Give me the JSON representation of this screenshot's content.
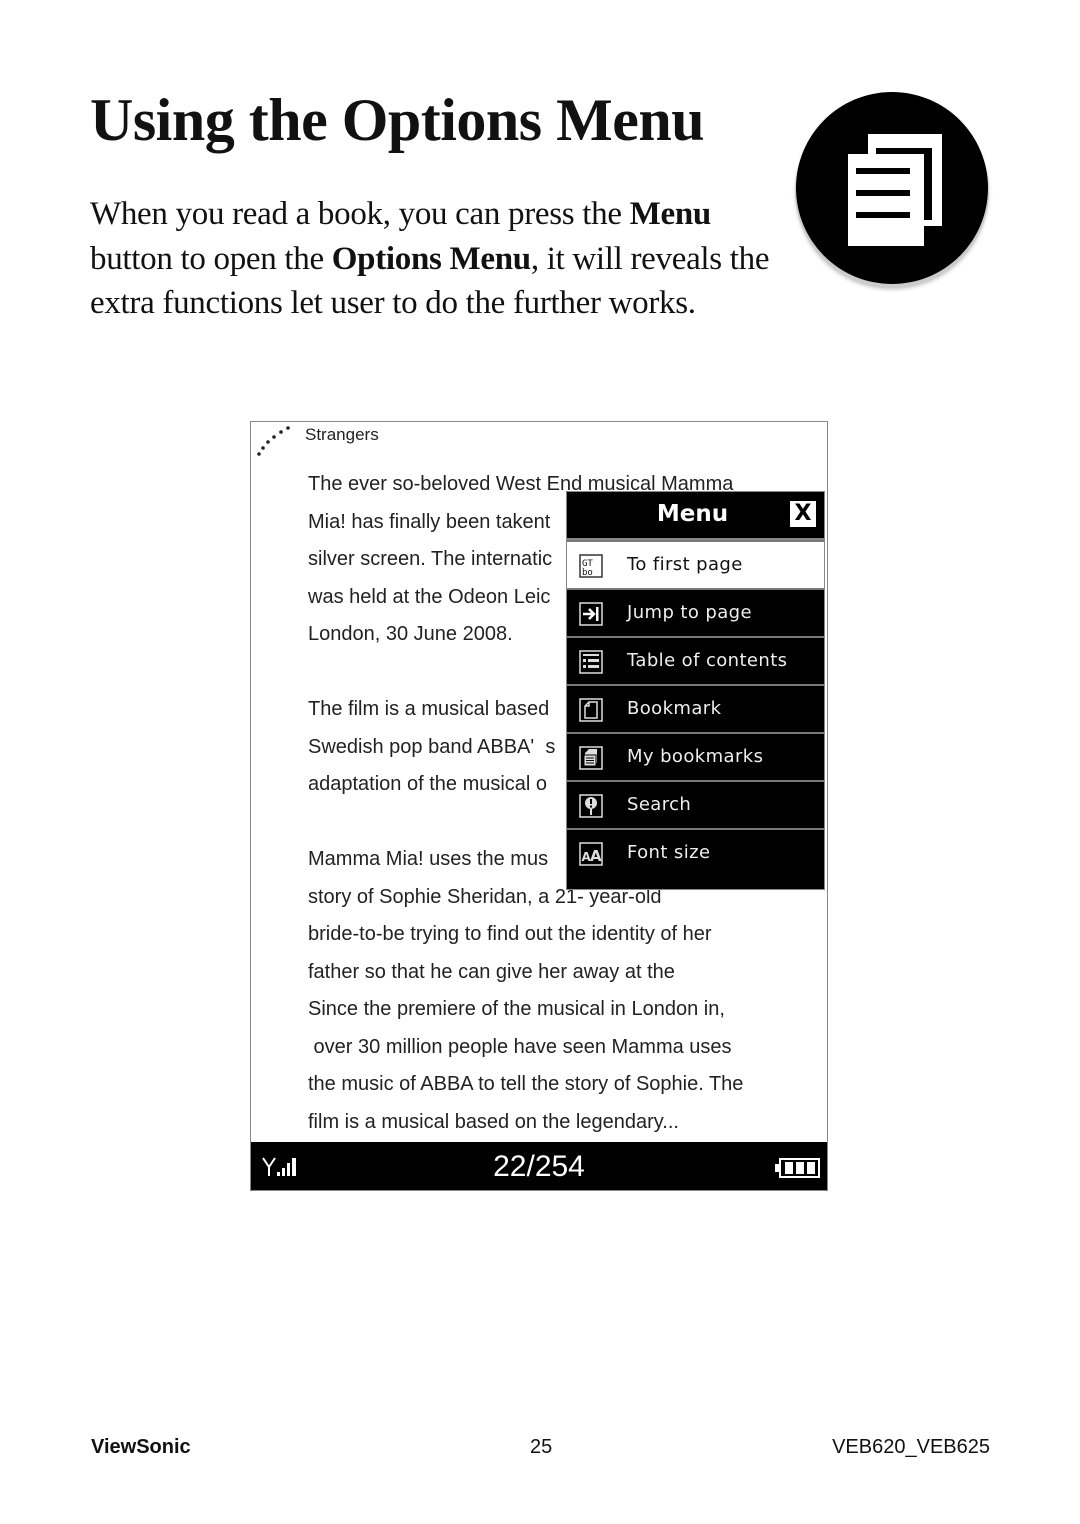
{
  "page": {
    "title": "Using the Options Menu",
    "intro": {
      "t1": "When you read a book, you can press the ",
      "b1": "Menu",
      "t2": " button to open the ",
      "b2": "Options Menu",
      "t3": ", it will reveals the extra functions let user to do the further works."
    },
    "badge_icon": "documents-icon"
  },
  "device": {
    "book_title": "Strangers",
    "text_lines": [
      "The ever so-beloved West End musical Mamma",
      "Mia! has finally been takent",
      "silver screen. The internatic",
      "was held at the Odeon Leic",
      "London, 30 June 2008.",
      "",
      "The film is a musical based",
      "Swedish pop band ABBA'  s",
      "adaptation of the musical o",
      "",
      "Mamma Mia! uses the mus",
      "story of Sophie Sheridan, a 21- year-old",
      "bride-to-be trying to find out the identity of her",
      "father so that he can give her away at the",
      "Since the premiere of the musical in London in,",
      " over 30 million people have seen Mamma uses",
      "the music of ABBA to tell the story of Sophie. The",
      "film is a musical based on the legendary..."
    ],
    "status": {
      "page_indicator": "22/254",
      "signal_icon": "signal-icon",
      "battery_icon": "battery-icon"
    },
    "menu": {
      "title": "Menu",
      "close_label": "X",
      "items": [
        {
          "label": "To first page",
          "icon": "first-page-icon",
          "selected": true
        },
        {
          "label": "Jump to page",
          "icon": "jump-icon",
          "selected": false
        },
        {
          "label": "Table of contents",
          "icon": "toc-icon",
          "selected": false
        },
        {
          "label": "Bookmark",
          "icon": "bookmark-icon",
          "selected": false
        },
        {
          "label": "My bookmarks",
          "icon": "my-bookmarks-icon",
          "selected": false
        },
        {
          "label": "Search",
          "icon": "search-icon",
          "selected": false
        },
        {
          "label": "Font size",
          "icon": "font-size-icon",
          "selected": false
        }
      ]
    }
  },
  "footer": {
    "brand": "ViewSonic",
    "page_number": "25",
    "model": "VEB620_VEB625"
  }
}
